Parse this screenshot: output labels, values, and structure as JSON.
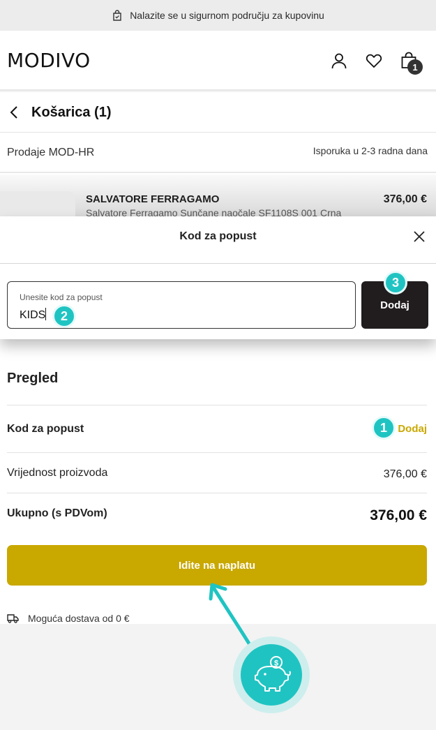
{
  "topbar": {
    "text": "Nalazite se u sigurnom području za kupovinu",
    "icon": "lock-bag-icon"
  },
  "header": {
    "logo": "MODIVO",
    "icons": [
      "user-icon",
      "heart-icon",
      "bag-icon"
    ],
    "cart_count": "1"
  },
  "cart": {
    "title": "Košarica (1)"
  },
  "seller": {
    "name": "Prodaje MOD-HR",
    "delivery": "Isporuka u 2-3 radna dana"
  },
  "product": {
    "brand": "SALVATORE FERRAGAMO",
    "name": "Salvatore Ferragamo Sunčane naočale SF1108S 001 Crna",
    "price": "376,00 €"
  },
  "promo_modal": {
    "title": "Kod za popust",
    "field_label": "Unesite kod za popust",
    "field_value": "KIDS",
    "add_button": "Dodaj"
  },
  "summary": {
    "title": "Pregled",
    "promo_label": "Kod za popust",
    "promo_action": "Dodaj",
    "products_label": "Vrijednost proizvoda",
    "products_value": "376,00 €",
    "total_label": "Ukupno (s PDVom)",
    "total_value": "376,00 €"
  },
  "checkout_button": "Idite na naplatu",
  "delivery_note": "Moguća dostava od 0 €",
  "markers": {
    "m1": "1",
    "m2": "2",
    "m3": "3"
  },
  "colors": {
    "accent": "#c9a800",
    "dark_button": "#211d1f",
    "marker": "#1fc4c2"
  }
}
